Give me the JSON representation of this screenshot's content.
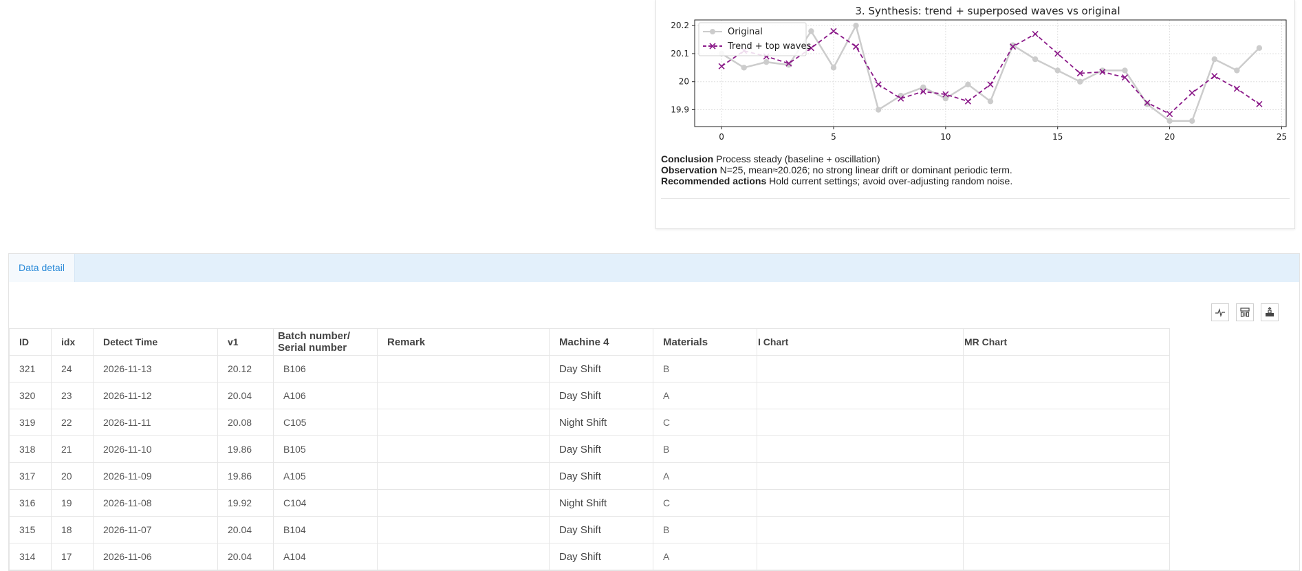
{
  "chart_panel": {
    "chart_data": {
      "type": "line",
      "title": "3. Synthesis: trend + superposed waves vs original",
      "xlabel": "",
      "ylabel": "",
      "xlim": [
        -1.2,
        25.2
      ],
      "ylim": [
        19.84,
        20.22
      ],
      "x_ticks": [
        0,
        5,
        10,
        15,
        20,
        25
      ],
      "y_ticks": [
        19.9,
        20.0,
        20.1,
        20.2
      ],
      "grid": true,
      "legend_position": "top-left",
      "series": [
        {
          "name": "Original",
          "color": "#cccccc",
          "marker": "circle",
          "line_style": "solid",
          "x": [
            0,
            1,
            2,
            3,
            4,
            5,
            6,
            7,
            8,
            9,
            10,
            11,
            12,
            13,
            14,
            15,
            16,
            17,
            18,
            19,
            20,
            21,
            22,
            23,
            24
          ],
          "values": [
            20.1,
            20.05,
            20.07,
            20.06,
            20.18,
            20.05,
            20.2,
            19.9,
            19.95,
            19.98,
            19.94,
            19.99,
            19.93,
            20.13,
            20.08,
            20.04,
            20.0,
            20.04,
            20.04,
            19.92,
            19.86,
            19.86,
            20.08,
            20.04,
            20.12
          ]
        },
        {
          "name": "Trend + top waves",
          "color": "#8b1a89",
          "marker": "x",
          "line_style": "dashed",
          "x": [
            0,
            1,
            2,
            3,
            4,
            5,
            6,
            7,
            8,
            9,
            10,
            11,
            12,
            13,
            14,
            15,
            16,
            17,
            18,
            19,
            20,
            21,
            22,
            23,
            24
          ],
          "values": [
            20.055,
            20.11,
            20.09,
            20.065,
            20.12,
            20.18,
            20.125,
            19.99,
            19.94,
            19.965,
            19.955,
            19.93,
            19.99,
            20.125,
            20.17,
            20.1,
            20.03,
            20.035,
            20.015,
            19.925,
            19.885,
            19.96,
            20.02,
            19.975,
            19.92
          ]
        }
      ]
    },
    "notes": {
      "conclusion_label": "Conclusion",
      "conclusion_text": "Process steady (baseline + oscillation)",
      "observation_label": "Observation",
      "observation_text": "N=25, mean≈20.026; no strong linear drift or dominant periodic term.",
      "actions_label": "Recommended actions",
      "actions_text": "Hold current settings; avoid over-adjusting random noise."
    }
  },
  "data_panel": {
    "tab_label": "Data detail",
    "toolbar_icons": [
      "line-chart-icon",
      "columns-icon",
      "export-icon"
    ],
    "columns": [
      "ID",
      "idx",
      "Detect Time",
      "v1",
      "Batch number/\nSerial number",
      "Remark",
      "Machine 4",
      "Materials",
      "I Chart",
      "MR Chart"
    ],
    "rows": [
      [
        "321",
        "24",
        "2026-11-13",
        "20.12",
        "B106",
        "",
        "Day Shift",
        "B",
        "",
        ""
      ],
      [
        "320",
        "23",
        "2026-11-12",
        "20.04",
        "A106",
        "",
        "Day Shift",
        "A",
        "",
        ""
      ],
      [
        "319",
        "22",
        "2026-11-11",
        "20.08",
        "C105",
        "",
        "Night Shift",
        "C",
        "",
        ""
      ],
      [
        "318",
        "21",
        "2026-11-10",
        "19.86",
        "B105",
        "",
        "Day Shift",
        "B",
        "",
        ""
      ],
      [
        "317",
        "20",
        "2026-11-09",
        "19.86",
        "A105",
        "",
        "Day Shift",
        "A",
        "",
        ""
      ],
      [
        "316",
        "19",
        "2026-11-08",
        "19.92",
        "C104",
        "",
        "Night Shift",
        "C",
        "",
        ""
      ],
      [
        "315",
        "18",
        "2026-11-07",
        "20.04",
        "B104",
        "",
        "Day Shift",
        "B",
        "",
        ""
      ],
      [
        "314",
        "17",
        "2026-11-06",
        "20.04",
        "A104",
        "",
        "Day Shift",
        "A",
        "",
        ""
      ]
    ]
  }
}
